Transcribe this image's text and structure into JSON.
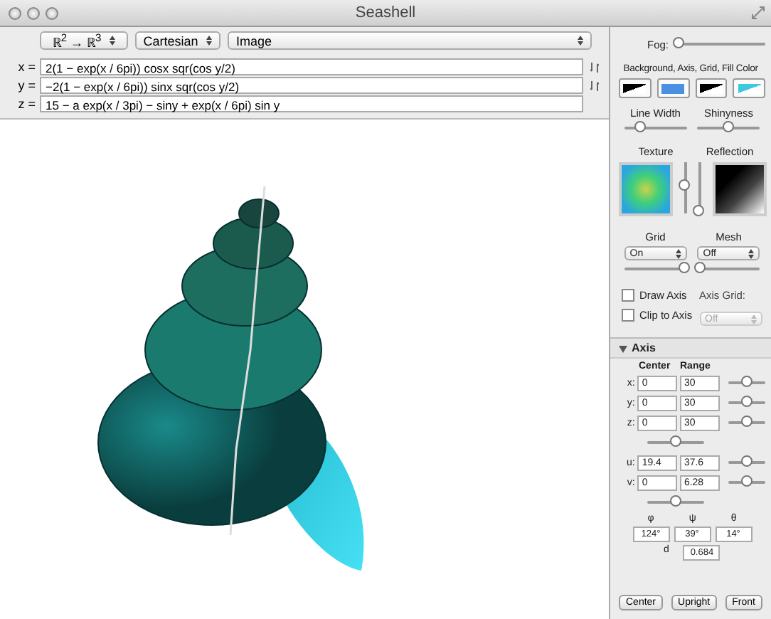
{
  "window": {
    "title": "Seashell"
  },
  "toolbar": {
    "selects": [
      {
        "value": "ℝ$^{2}$ → ℝ$^{3}$"
      },
      {
        "value": "Cartesian"
      },
      {
        "value": "Image"
      }
    ]
  },
  "equations": [
    {
      "label": "x =",
      "value": "2(1 − exp(x / 6pi)) cosx sqr(cos y/2)"
    },
    {
      "label": "y =",
      "value": "−2(1 − exp(x / 6pi)) sinx sqr(cos y/2)"
    },
    {
      "label": "z =",
      "value": "15 − a exp(x / 3pi) − siny + exp(x / 6pi) sin y"
    }
  ],
  "panel": {
    "fog": {
      "label": "Fog:",
      "level": 0.02
    },
    "colors_label": "Background, Axis, Grid, Fill Color",
    "swatches": [
      {
        "kind": "split",
        "color": "#000000"
      },
      {
        "kind": "solid",
        "color": "#4a90e2"
      },
      {
        "kind": "split",
        "color": "#000000"
      },
      {
        "kind": "split",
        "color": "#3ec8e0"
      }
    ],
    "line_width": {
      "label": "Line Width",
      "level": 0.25
    },
    "shininess": {
      "label": "Shinyness",
      "level": 0.5
    },
    "texture": {
      "label": "Texture",
      "level": 0.55
    },
    "reflection": {
      "label": "Reflection",
      "level": 0.05
    },
    "grid": {
      "label": "Grid",
      "value": "On",
      "level": 0.95
    },
    "mesh": {
      "label": "Mesh",
      "value": "Off",
      "level": 0.05
    },
    "checks": [
      {
        "label": "Draw Axis",
        "checked": false
      },
      {
        "label": "Clip to Axis",
        "checked": false
      }
    ],
    "axis_grid": {
      "label": "Axis Grid:",
      "value": "Off",
      "disabled": true
    },
    "axis": {
      "title": "Axis",
      "expanded": true,
      "headers": [
        "Center",
        "Range"
      ],
      "rows": [
        {
          "label": "x:",
          "center": "0",
          "range": "30",
          "level": 0.5
        },
        {
          "label": "y:",
          "center": "0",
          "range": "30",
          "level": 0.5
        },
        {
          "label": "z:",
          "center": "0",
          "range": "30",
          "level": 0.5
        }
      ],
      "slider_1": {
        "level": 0.5
      },
      "rows_2": [
        {
          "label": "u:",
          "center": "19.4",
          "range": "37.6",
          "level": 0.5
        },
        {
          "label": "v:",
          "center": "0",
          "range": "6.28",
          "level": 0.5
        }
      ],
      "slider_2": {
        "level": 0.5
      },
      "angle_labels": [
        "φ",
        "ψ",
        "θ"
      ],
      "angles": [
        "124°",
        "39°",
        "14°"
      ],
      "d_label": "d",
      "d_value": "0.684"
    },
    "buttons": [
      "Center",
      "Upright",
      "Front"
    ]
  }
}
